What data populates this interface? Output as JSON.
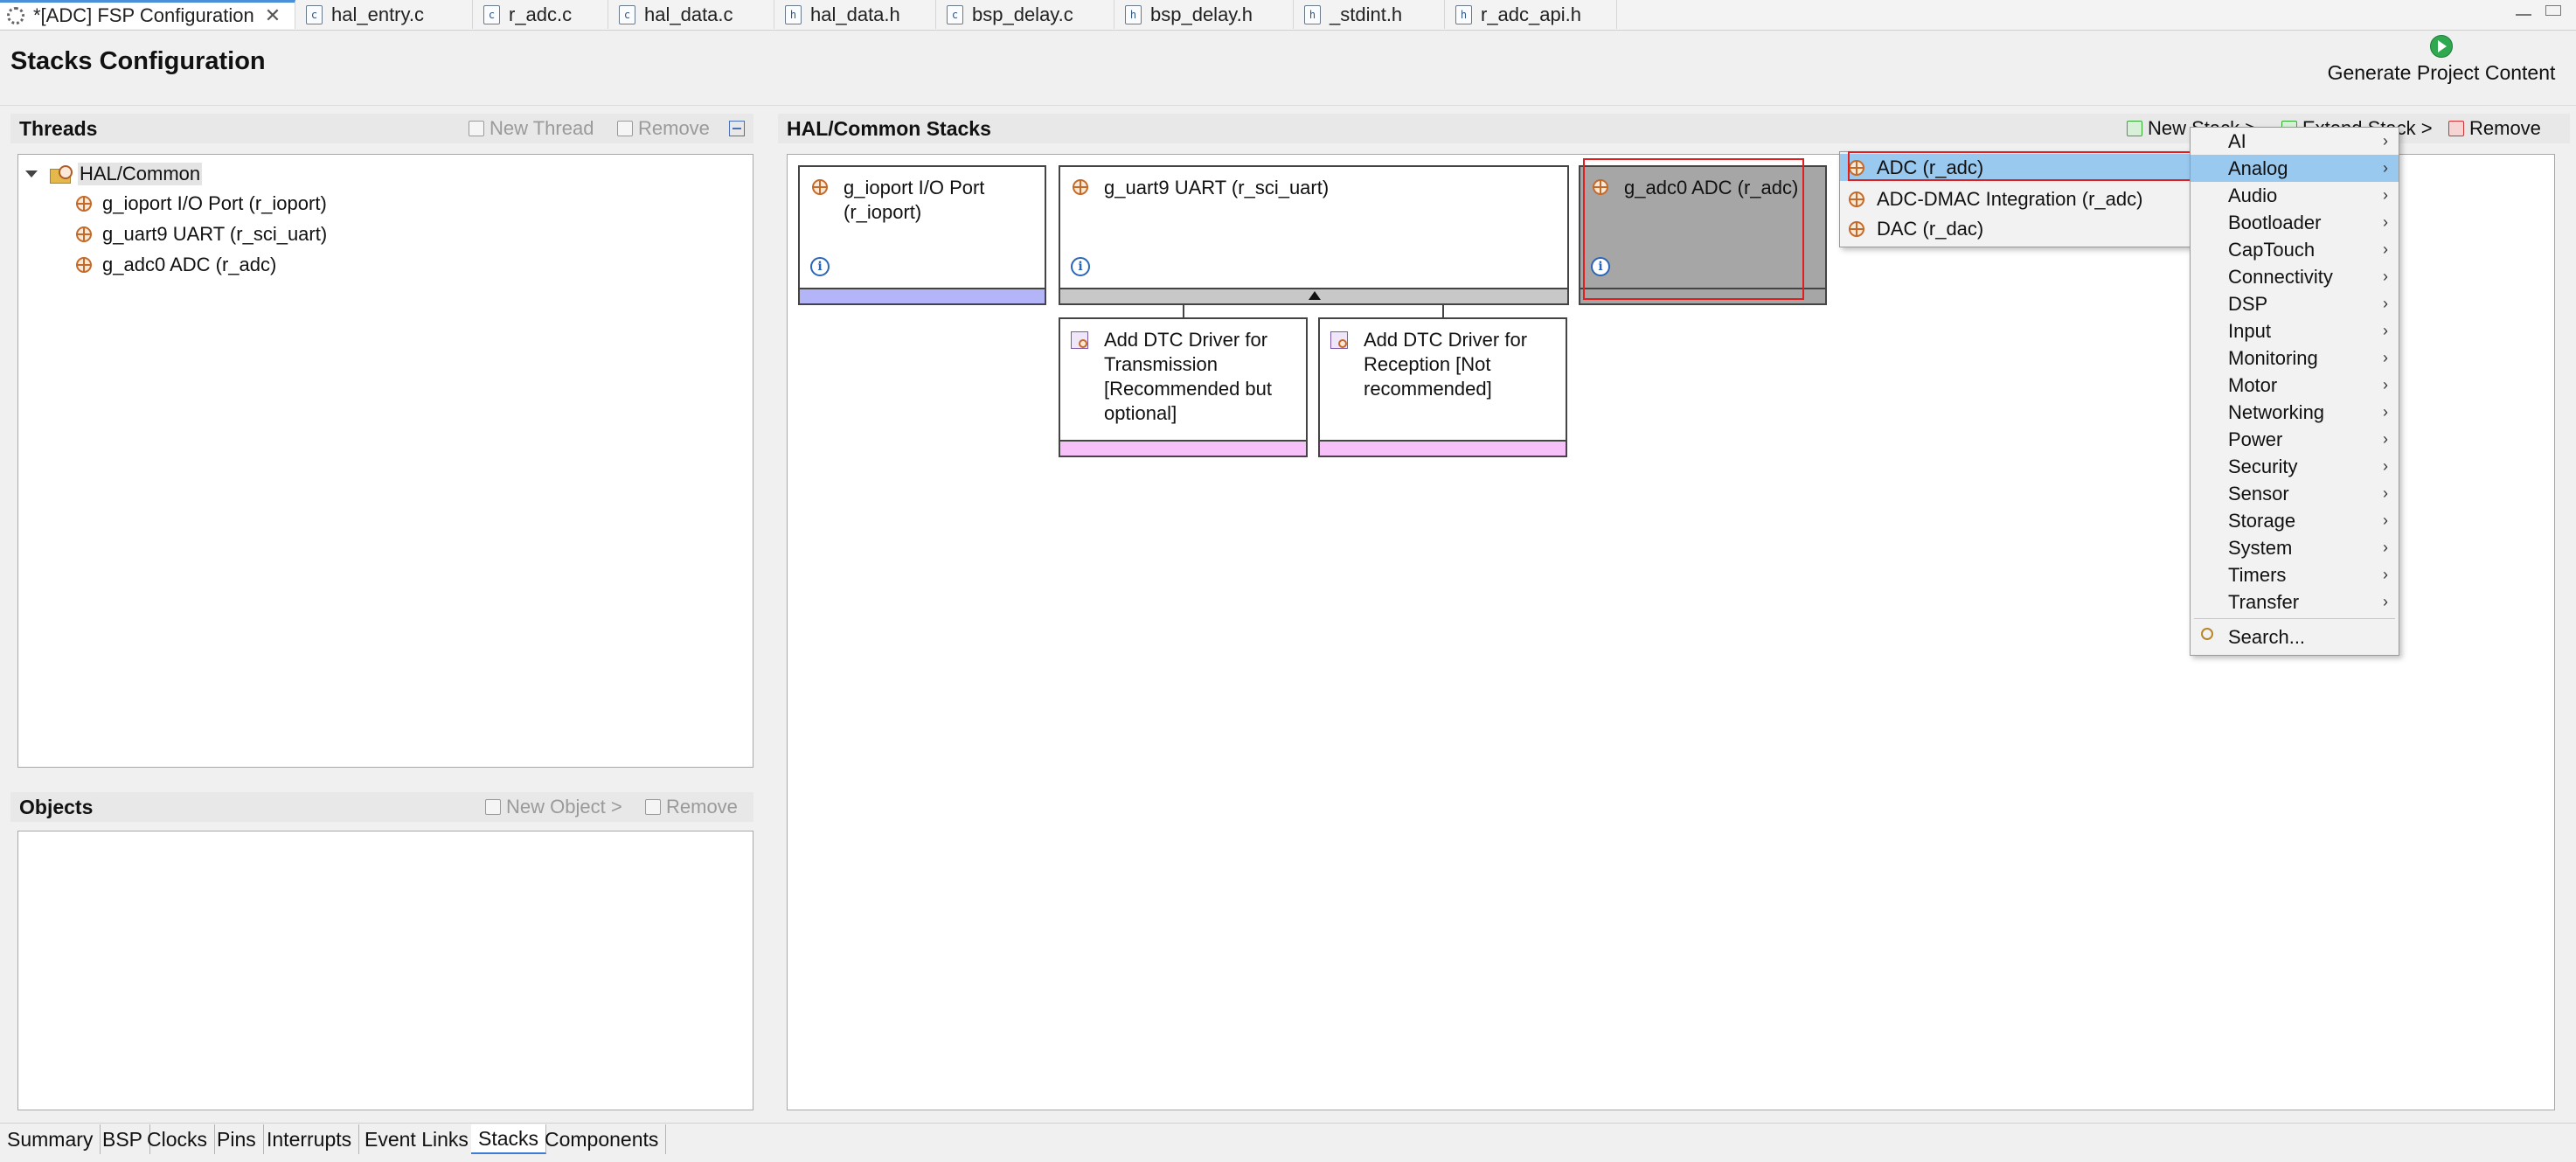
{
  "editor_tabs": [
    {
      "label": "*[ADC] FSP Configuration",
      "active": true,
      "icon": "gear-icon"
    },
    {
      "label": "hal_entry.c",
      "icon": "c-file-icon"
    },
    {
      "label": "r_adc.c",
      "icon": "c-file-icon"
    },
    {
      "label": "hal_data.c",
      "icon": "c-file-icon"
    },
    {
      "label": "hal_data.h",
      "icon": "h-file-icon"
    },
    {
      "label": "bsp_delay.c",
      "icon": "c-file-icon"
    },
    {
      "label": "bsp_delay.h",
      "icon": "h-file-icon"
    },
    {
      "label": "_stdint.h",
      "icon": "h-file-icon"
    },
    {
      "label": "r_adc_api.h",
      "icon": "h-file-icon"
    }
  ],
  "header": {
    "title": "Stacks Configuration",
    "generate_label": "Generate Project Content"
  },
  "threads": {
    "title": "Threads",
    "new_thread": "New Thread",
    "remove": "Remove",
    "root": "HAL/Common",
    "items": [
      "g_ioport I/O Port (r_ioport)",
      "g_uart9 UART (r_sci_uart)",
      "g_adc0 ADC (r_adc)"
    ]
  },
  "objects": {
    "title": "Objects",
    "new_object": "New Object >",
    "remove": "Remove"
  },
  "stacks": {
    "title": "HAL/Common Stacks",
    "new_stack": "New Stack >",
    "extend_stack": "Extend Stack >",
    "remove": "Remove",
    "ioport_label": "g_ioport I/O Port (r_ioport)",
    "uart_label": "g_uart9 UART (r_sci_uart)",
    "adc_label": "g_adc0 ADC (r_adc)",
    "dtc_tx": "Add DTC Driver for Transmission [Recommended but optional]",
    "dtc_rx": "Add DTC Driver for Reception [Not recommended]",
    "colors": {
      "ioport_stripe": "#b4b4f8",
      "uart_stripe": "#c8c8c8",
      "adc_fill": "#a6a6a6",
      "dtc_stripe": "#f8c0f8"
    }
  },
  "submenu_analog": [
    "ADC (r_adc)",
    "ADC-DMAC Integration (r_adc)",
    "DAC (r_dac)"
  ],
  "new_stack_menu": {
    "items": [
      "AI",
      "Analog",
      "Audio",
      "Bootloader",
      "CapTouch",
      "Connectivity",
      "DSP",
      "Input",
      "Monitoring",
      "Motor",
      "Networking",
      "Power",
      "Security",
      "Sensor",
      "Storage",
      "System",
      "Timers",
      "Transfer"
    ],
    "selected": "Analog",
    "search": "Search..."
  },
  "bottom_tabs": [
    "Summary",
    "BSP",
    "Clocks",
    "Pins",
    "Interrupts",
    "Event Links",
    "Stacks",
    "Components"
  ],
  "active_bottom_tab": "Stacks"
}
